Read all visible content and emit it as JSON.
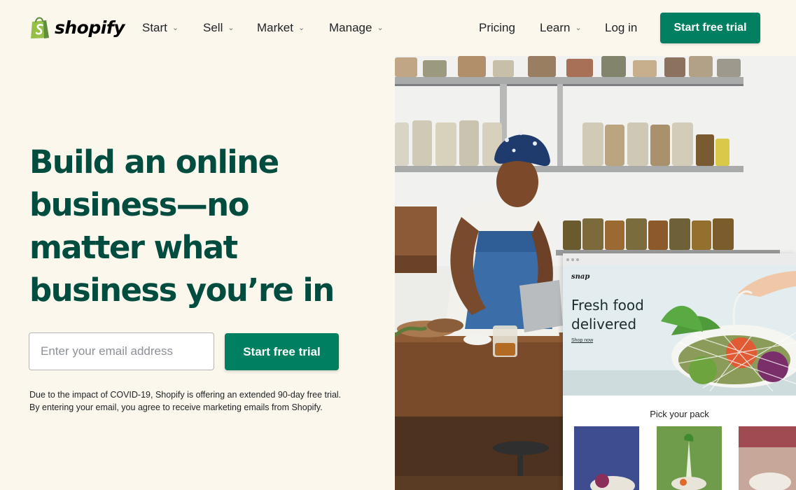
{
  "header": {
    "logo_text": "shopify",
    "nav": {
      "start": "Start",
      "sell": "Sell",
      "market": "Market",
      "manage": "Manage",
      "pricing": "Pricing",
      "learn": "Learn",
      "login": "Log in"
    },
    "cta_label": "Start free trial"
  },
  "hero": {
    "headline": "Build an online business—no matter what business you’re in",
    "email_placeholder": "Enter your email address",
    "cta_label": "Start free trial",
    "disclaimer_line1": "Due to the impact of COVID-19, Shopify is offering an extended 90-day free trial.",
    "disclaimer_line2": "By entering your email, you agree to receive marketing emails from Shopify."
  },
  "mockup": {
    "brand": "snap",
    "heading": "Fresh food delivered",
    "link": "Shop now",
    "section_title": "Pick your pack"
  },
  "colors": {
    "brand_green": "#008060",
    "headline_green": "#004c3f",
    "background": "#fbf7ed"
  },
  "icons": {
    "logo": "shopify-bag-icon",
    "dropdown": "chevron-down-icon"
  }
}
